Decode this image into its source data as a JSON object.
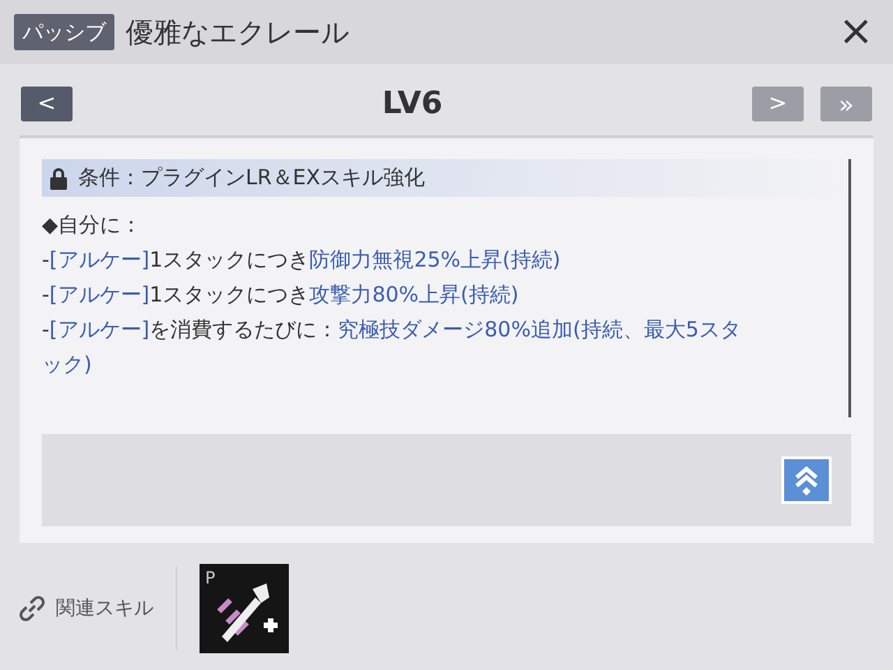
{
  "header": {
    "badge": "パッシブ",
    "title": "優雅なエクレール",
    "close": "×"
  },
  "level_bar": {
    "prev": "<",
    "level": "LV6",
    "next": ">",
    "last": "»"
  },
  "condition": "条件：プラグインLR＆EXスキル強化",
  "lines": [
    [
      {
        "text": "◆自分に：",
        "highlight": false
      }
    ],
    [
      {
        "text": "-",
        "highlight": false
      },
      {
        "text": "[アルケー]",
        "highlight": true
      },
      {
        "text": "1スタックにつき",
        "highlight": false
      },
      {
        "text": "防御力無視25%上昇(持続)",
        "highlight": true
      }
    ],
    [
      {
        "text": "-",
        "highlight": false
      },
      {
        "text": "[アルケー]",
        "highlight": true
      },
      {
        "text": "1スタックにつき",
        "highlight": false
      },
      {
        "text": "攻撃力80%上昇(持続)",
        "highlight": true
      }
    ],
    [
      {
        "text": "-",
        "highlight": false
      },
      {
        "text": "[アルケー]",
        "highlight": true
      },
      {
        "text": "を消費するたびに：",
        "highlight": false
      },
      {
        "text": "究極技ダメージ80%追加(持続、最大5スタック)",
        "highlight": true
      }
    ]
  ],
  "related": {
    "label": "関連スキル",
    "skill_badge": "P"
  }
}
